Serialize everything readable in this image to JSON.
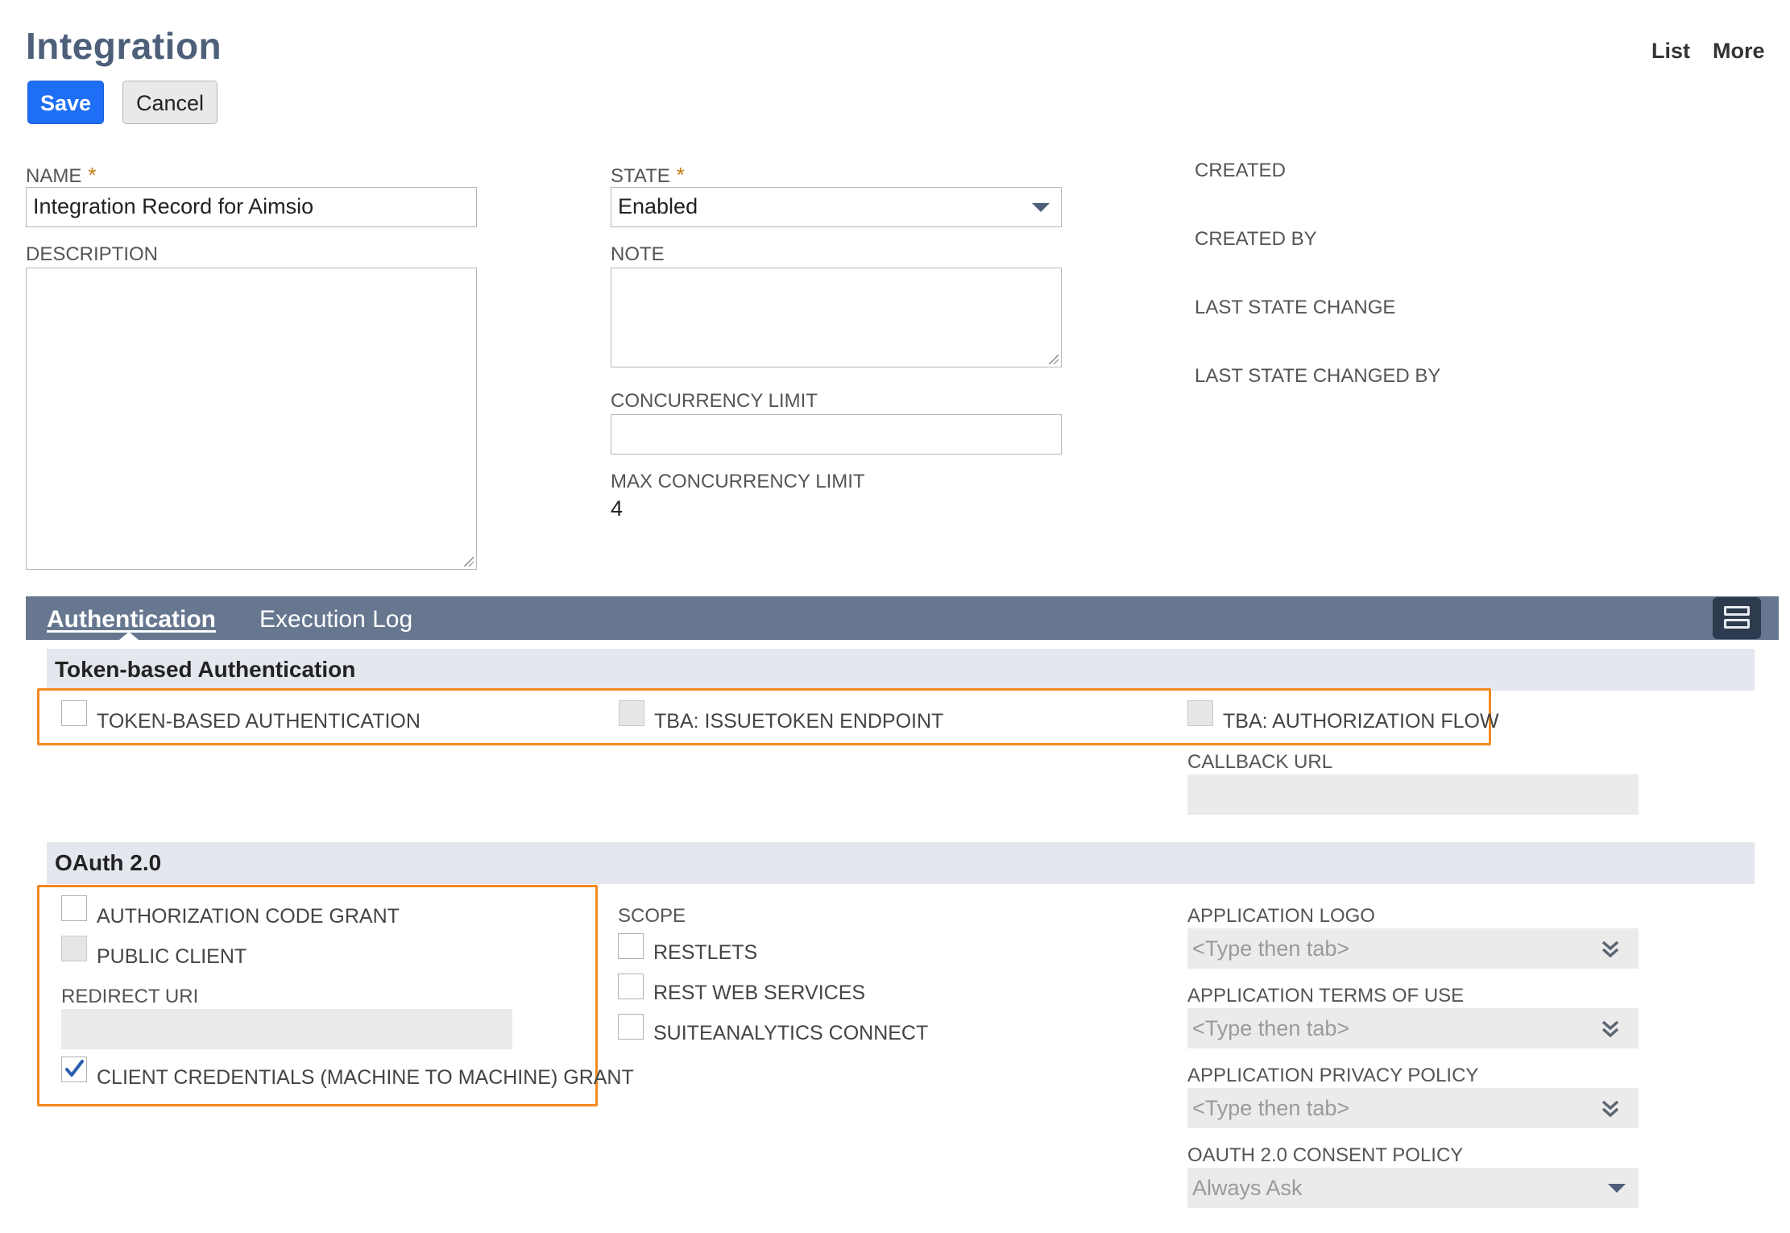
{
  "page": {
    "title": "Integration"
  },
  "top_links": {
    "list": "List",
    "more": "More"
  },
  "buttons": {
    "save": "Save",
    "cancel": "Cancel"
  },
  "form": {
    "required_mark": "*",
    "name": {
      "label": "NAME",
      "value": "Integration Record for Aimsio"
    },
    "description": {
      "label": "DESCRIPTION",
      "value": ""
    },
    "state": {
      "label": "STATE",
      "value": "Enabled"
    },
    "note": {
      "label": "NOTE",
      "value": ""
    },
    "concurrency_limit": {
      "label": "CONCURRENCY LIMIT",
      "value": ""
    },
    "max_concurrency_limit": {
      "label": "MAX CONCURRENCY LIMIT",
      "value": "4"
    },
    "meta": {
      "created": "CREATED",
      "created_by": "CREATED BY",
      "last_state_change": "LAST STATE CHANGE",
      "last_state_changed_by": "LAST STATE CHANGED BY"
    }
  },
  "tabs": [
    {
      "label": "Authentication",
      "active": true
    },
    {
      "label": "Execution Log",
      "active": false
    }
  ],
  "tba": {
    "section_title": "Token-based Authentication",
    "token_based_auth": {
      "label": "TOKEN-BASED AUTHENTICATION",
      "checked": false,
      "disabled": false
    },
    "issuetoken_endpoint": {
      "label": "TBA: ISSUETOKEN ENDPOINT",
      "checked": false,
      "disabled": true
    },
    "authorization_flow": {
      "label": "TBA: AUTHORIZATION FLOW",
      "checked": false,
      "disabled": true
    },
    "callback_url": {
      "label": "CALLBACK URL",
      "value": ""
    }
  },
  "oauth": {
    "section_title": "OAuth 2.0",
    "authorization_code_grant": {
      "label": "AUTHORIZATION CODE GRANT",
      "checked": false
    },
    "public_client": {
      "label": "PUBLIC CLIENT",
      "checked": false,
      "disabled": true
    },
    "redirect_uri": {
      "label": "REDIRECT URI",
      "value": ""
    },
    "client_credentials": {
      "label": "CLIENT CREDENTIALS (MACHINE TO MACHINE) GRANT",
      "checked": true
    },
    "scope": {
      "label": "SCOPE",
      "restlets": "RESTLETS",
      "rest_web_services": "REST WEB SERVICES",
      "suiteanalytics_connect": "SUITEANALYTICS CONNECT"
    },
    "application_logo": {
      "label": "APPLICATION LOGO",
      "placeholder": "<Type then tab>"
    },
    "application_terms": {
      "label": "APPLICATION TERMS OF USE",
      "placeholder": "<Type then tab>"
    },
    "application_privacy": {
      "label": "APPLICATION PRIVACY POLICY",
      "placeholder": "<Type then tab>"
    },
    "consent_policy": {
      "label": "OAUTH 2.0 CONSENT POLICY",
      "value": "Always Ask"
    }
  },
  "colors": {
    "accent": "#1e6ff6",
    "title": "#4d5f79",
    "tab_bar": "#66778f",
    "section_bg": "#e4e7ed",
    "highlight": "#f28a1f",
    "required": "#c77a12"
  }
}
